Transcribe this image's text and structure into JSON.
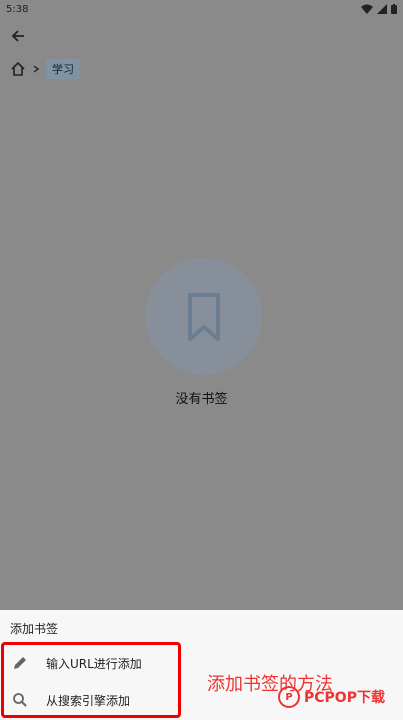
{
  "status_bar": {
    "time": "5:38"
  },
  "breadcrumb": {
    "current": "学习"
  },
  "empty_state": {
    "text": "没有书签"
  },
  "sheet": {
    "title": "添加书签",
    "items": [
      {
        "label": "输入URL进行添加",
        "icon": "pencil-icon"
      },
      {
        "label": "从搜索引擎添加",
        "icon": "search-icon"
      }
    ]
  },
  "annotation": {
    "text": "添加书签的方法"
  },
  "watermark": {
    "brand": "PCPOP下载"
  },
  "colors": {
    "highlight": "#ee0000",
    "annotation": "#e33333"
  }
}
